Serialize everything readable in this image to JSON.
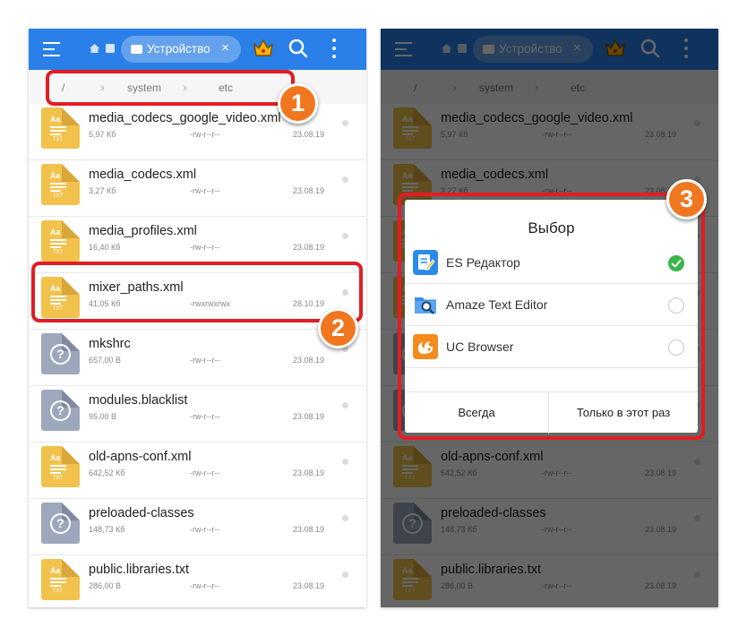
{
  "toolbar": {
    "chip_label": "Устройство",
    "chip_close": "×"
  },
  "breadcrumb": {
    "items": [
      "/",
      "system",
      "etc"
    ]
  },
  "files": [
    {
      "name": "media_codecs_google_video.xml",
      "size": "5,97 Кб",
      "perm": "-rw-r--r--",
      "date": "23.08.19",
      "type": "txt"
    },
    {
      "name": "media_codecs.xml",
      "size": "3,27 Кб",
      "perm": "-rw-r--r--",
      "date": "23.08.19",
      "type": "txt"
    },
    {
      "name": "media_profiles.xml",
      "size": "16,40 Кб",
      "perm": "-rw-r--r--",
      "date": "23.08.19",
      "type": "txt"
    },
    {
      "name": "mixer_paths.xml",
      "size": "41,05 Кб",
      "perm": "-rwxrwxrwx",
      "date": "28.10.19",
      "type": "txt"
    },
    {
      "name": "mkshrc",
      "size": "657,00 B",
      "perm": "-rw-r--r--",
      "date": "23.08.19",
      "type": "unknown"
    },
    {
      "name": "modules.blacklist",
      "size": "95,00 B",
      "perm": "-rw-r--r--",
      "date": "23.08.19",
      "type": "unknown"
    },
    {
      "name": "old-apns-conf.xml",
      "size": "642,52 Кб",
      "perm": "-rw-r--r--",
      "date": "23.08.19",
      "type": "txt"
    },
    {
      "name": "preloaded-classes",
      "size": "148,73 Кб",
      "perm": "-rw-r--r--",
      "date": "23.08.19",
      "type": "unknown"
    },
    {
      "name": "public.libraries.txt",
      "size": "286,00 B",
      "perm": "-rw-r--r--",
      "date": "23.08.19",
      "type": "txt"
    }
  ],
  "file_icon": {
    "txt_label": "TXT",
    "aa_label": "Aa",
    "unknown_glyph": "?"
  },
  "dialog": {
    "title": "Выбор",
    "options": [
      {
        "label": "ES Редактор",
        "icon": "es-editor-icon",
        "selected": true
      },
      {
        "label": "Amaze Text Editor",
        "icon": "amaze-text-editor-icon",
        "selected": false
      },
      {
        "label": "UC Browser",
        "icon": "uc-browser-icon",
        "selected": false
      }
    ],
    "always_label": "Всегда",
    "just_once_label": "Только в этот раз"
  },
  "callouts": {
    "step1": "1",
    "step2": "2",
    "step3": "3"
  },
  "colors": {
    "toolbar": "#2a7fe8",
    "callout_border": "#e21d23",
    "badge": "#f07720",
    "selected": "#39b54a",
    "txt_icon": "#f2c24c",
    "unknown_icon": "#9ea8bc"
  }
}
